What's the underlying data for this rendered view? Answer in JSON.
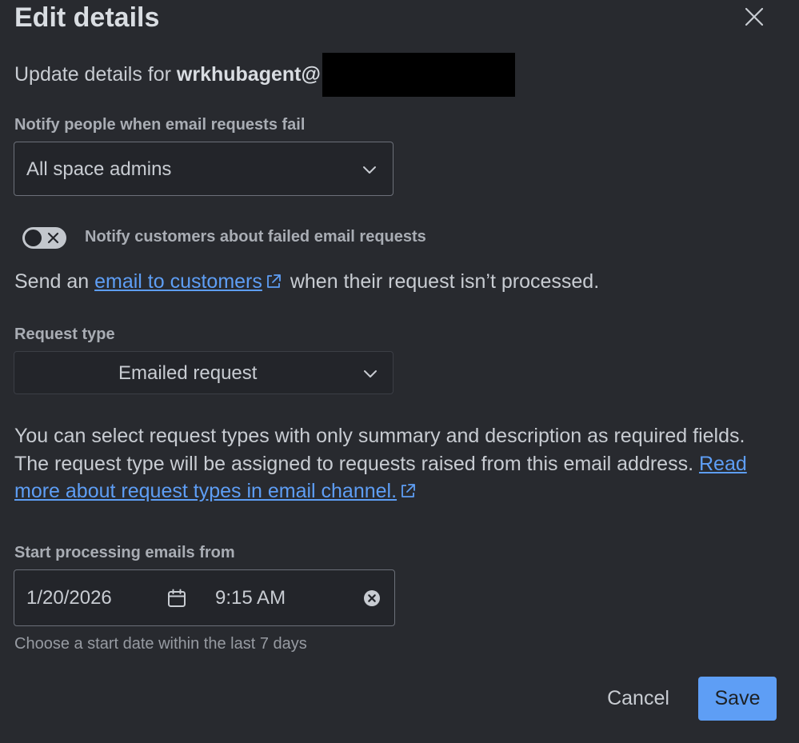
{
  "dialog": {
    "title": "Edit details",
    "close_label": "Close",
    "subtitle_prefix": "Update details for ",
    "subtitle_email": "wrkhubagent@"
  },
  "notify_people": {
    "label": "Notify people when email requests fail",
    "selected": "All space admins",
    "icon": "chevron-down-icon"
  },
  "notify_customers": {
    "toggle_on": false,
    "label": "Notify customers about failed email requests",
    "text_before": "Send an ",
    "link_text": "email to customers",
    "text_after": " when their request isn’t processed."
  },
  "request_type": {
    "label": "Request type",
    "selected": "Emailed request",
    "description": "You can select request types with only summary and description as required fields. The request type will be assigned to requests raised from this email address. ",
    "link_text": "Read more about request types in email channel."
  },
  "start_processing": {
    "label": "Start processing emails from",
    "date": "1/20/2026",
    "time": "9:15 AM",
    "helper": "Choose a start date within the last 7 days"
  },
  "actions": {
    "cancel_label": "Cancel",
    "save_label": "Save"
  },
  "colors": {
    "background": "#282a2f",
    "link": "#5e9ef5",
    "primary_button": "#5e9ef5",
    "redaction": "#000000"
  }
}
